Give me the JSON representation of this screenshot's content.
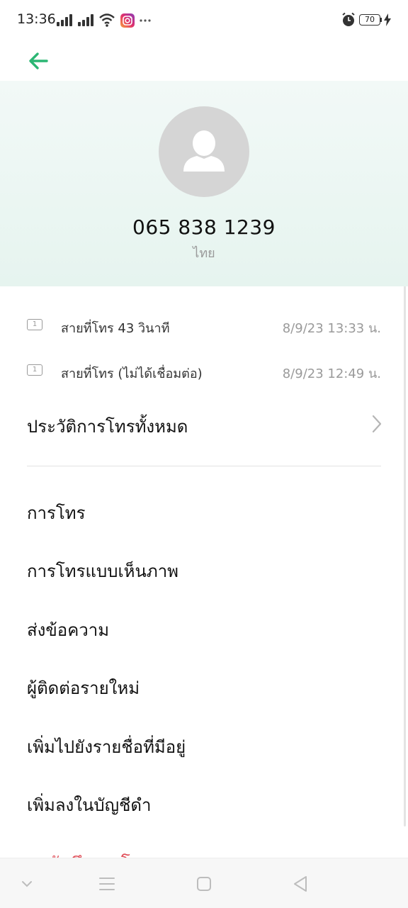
{
  "status_bar": {
    "time": "13:36",
    "battery": "70",
    "icons": [
      "signal-icon",
      "signal-icon",
      "wifi-icon",
      "instagram-icon",
      "more-dots-icon",
      "alarm-icon",
      "battery-icon",
      "charging-icon"
    ]
  },
  "header": {
    "back_icon": "arrow-left-icon",
    "accent_color": "#2bb673"
  },
  "contact": {
    "avatar_icon": "person-icon",
    "phone_number": "065 838 1239",
    "region": "ไทย"
  },
  "call_log": [
    {
      "sim": "1",
      "description": "สายที่โทร  43 วินาที",
      "datetime": "8/9/23 13:33 น."
    },
    {
      "sim": "1",
      "description": "สายที่โทร (ไม่ได้เชื่อมต่อ)",
      "datetime": "8/9/23 12:49 น."
    }
  ],
  "history": {
    "label": "ประวัติการโทรทั้งหมด",
    "icon": "chevron-right-icon"
  },
  "menu": {
    "call": "การโทร",
    "video_call": "การโทรแบบเห็นภาพ",
    "send_message": "ส่งข้อความ",
    "new_contact": "ผู้ติดต่อรายใหม่",
    "add_to_existing": "เพิ่มไปยังรายชื่อที่มีอยู่",
    "add_to_blacklist": "เพิ่มลงในบัญชีดำ",
    "delete_call_log": "ลบบันทึกการโทร"
  },
  "nav_bar": {
    "icons": [
      "chevron-down-icon",
      "menu-icon",
      "home-square-icon",
      "back-triangle-icon"
    ]
  }
}
